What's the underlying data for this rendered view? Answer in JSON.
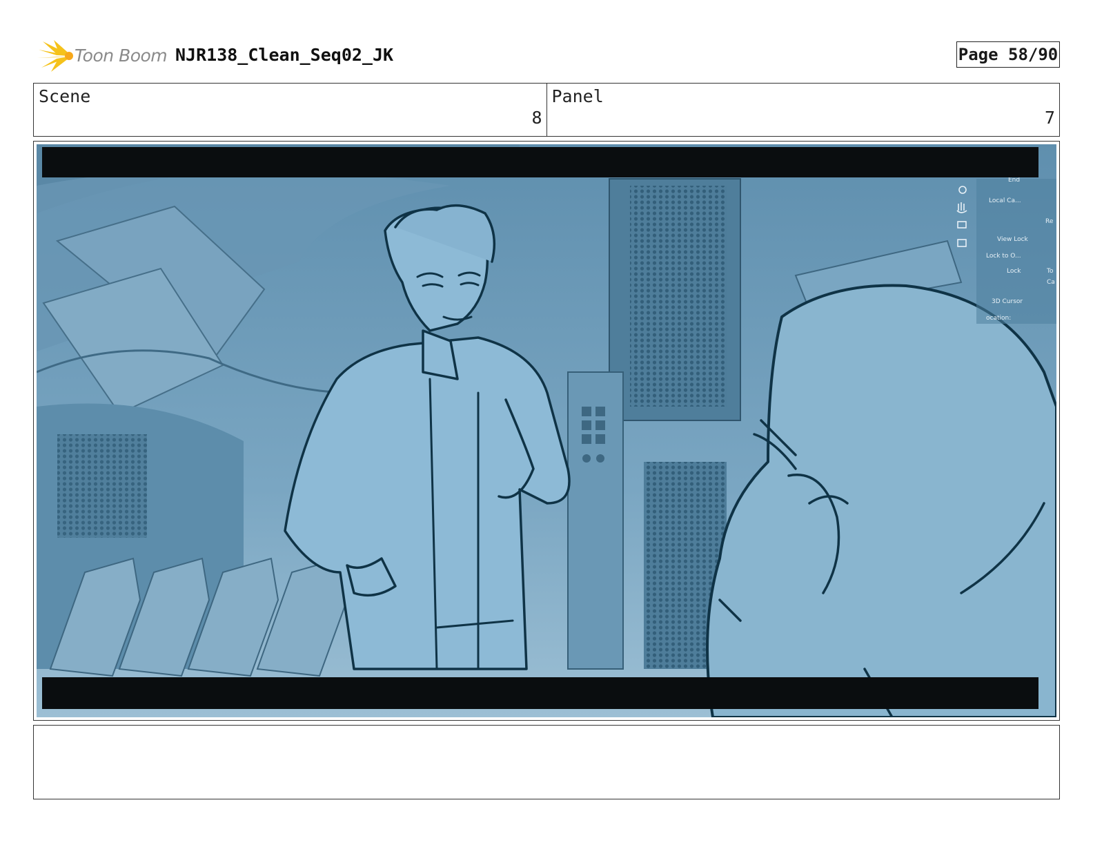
{
  "header": {
    "logo_text": "Toon Boom",
    "logo_icon": "sunburst-icon",
    "title": "NJR138_Clean_Seq02_JK",
    "page_label": "Page 58/90"
  },
  "scene": {
    "label": "Scene",
    "value": "8"
  },
  "panel": {
    "label": "Panel",
    "value": "7"
  },
  "viewport_ui": {
    "items": [
      "End",
      "Local Ca...",
      "Re",
      "View Lock",
      "Lock to O...",
      "Lock",
      "To",
      "Ca",
      "3D Cursor",
      "ocation:"
    ],
    "icons": [
      "zoom-icon",
      "hand-icon",
      "camera-icon",
      "grid-icon"
    ]
  },
  "notes": {
    "text": ""
  },
  "colors": {
    "tint": "#6f9fbe",
    "line_art": "#0f3346",
    "letterbox": "#0a0d0f",
    "logo_yellow": "#f5c21b"
  }
}
